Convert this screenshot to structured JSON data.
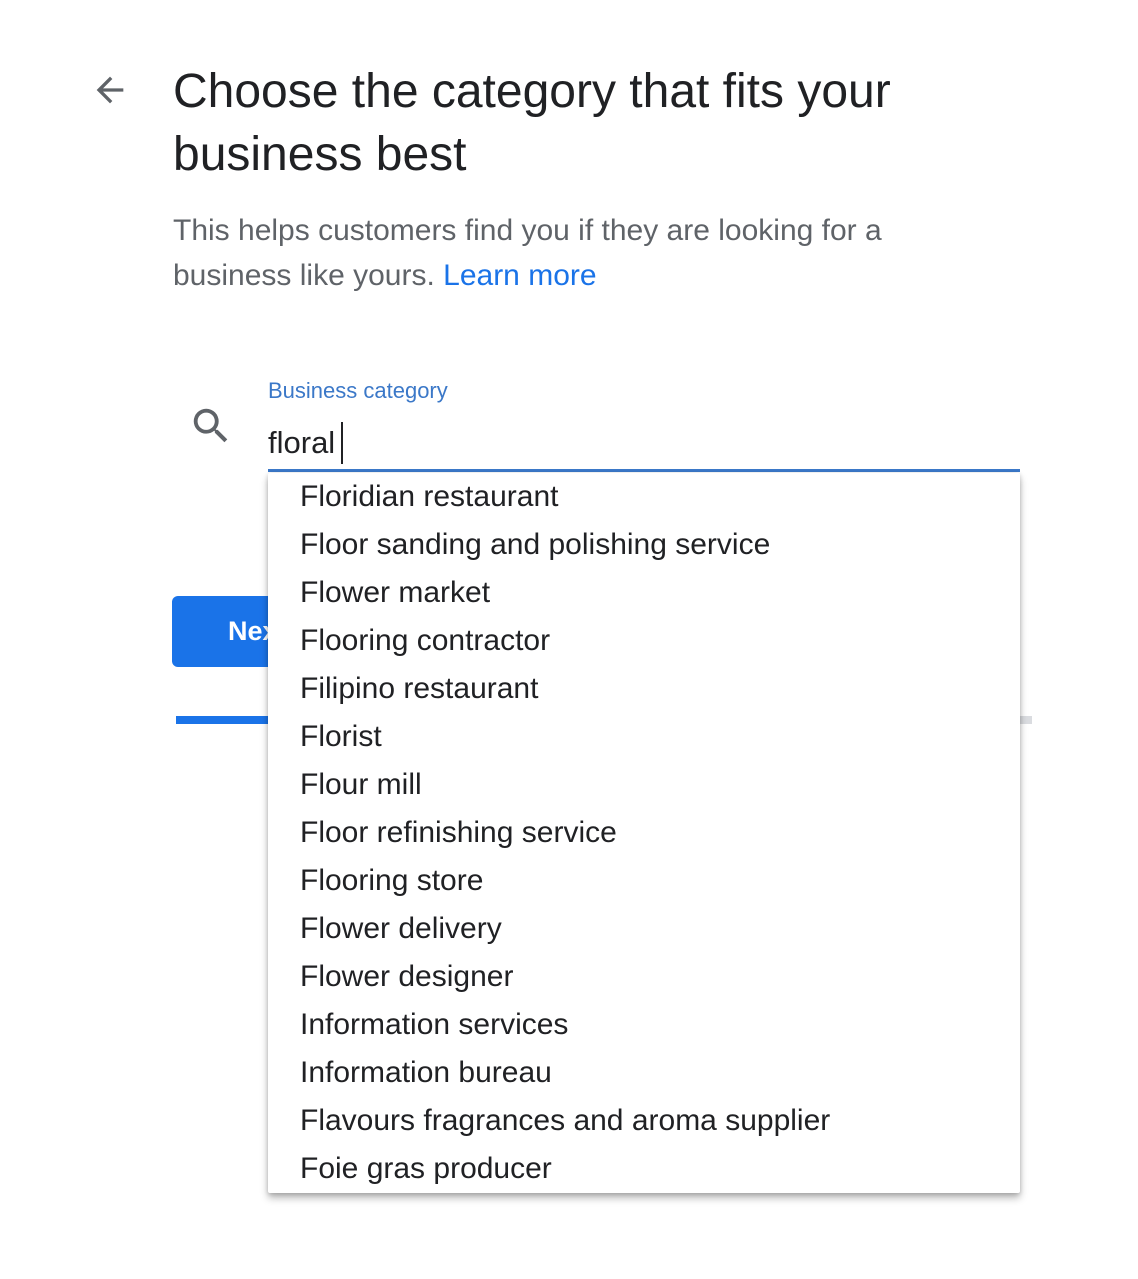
{
  "header": {
    "title": "Choose the category that fits your business best",
    "subtitle": "This helps customers find you if they are looking for a business like yours.",
    "learn_more": "Learn more",
    "back_icon": "arrow-left-icon"
  },
  "field": {
    "label": "Business category",
    "value": "floral",
    "search_icon": "search-icon"
  },
  "suggestions": [
    "Floridian restaurant",
    "Floor sanding and polishing service",
    "Flower market",
    "Flooring contractor",
    "Filipino restaurant",
    "Florist",
    "Flour mill",
    "Floor refinishing service",
    "Flooring store",
    "Flower delivery",
    "Flower designer",
    "Information services",
    "Information bureau",
    "Flavours fragrances and aroma supplier",
    "Foie gras producer"
  ],
  "footer": {
    "next_label": "Next",
    "progress_fraction": 0.14
  },
  "colors": {
    "accent": "#1a73e8",
    "label_blue": "#3b78c8",
    "text": "#202124",
    "secondary_text": "#5f6368"
  }
}
